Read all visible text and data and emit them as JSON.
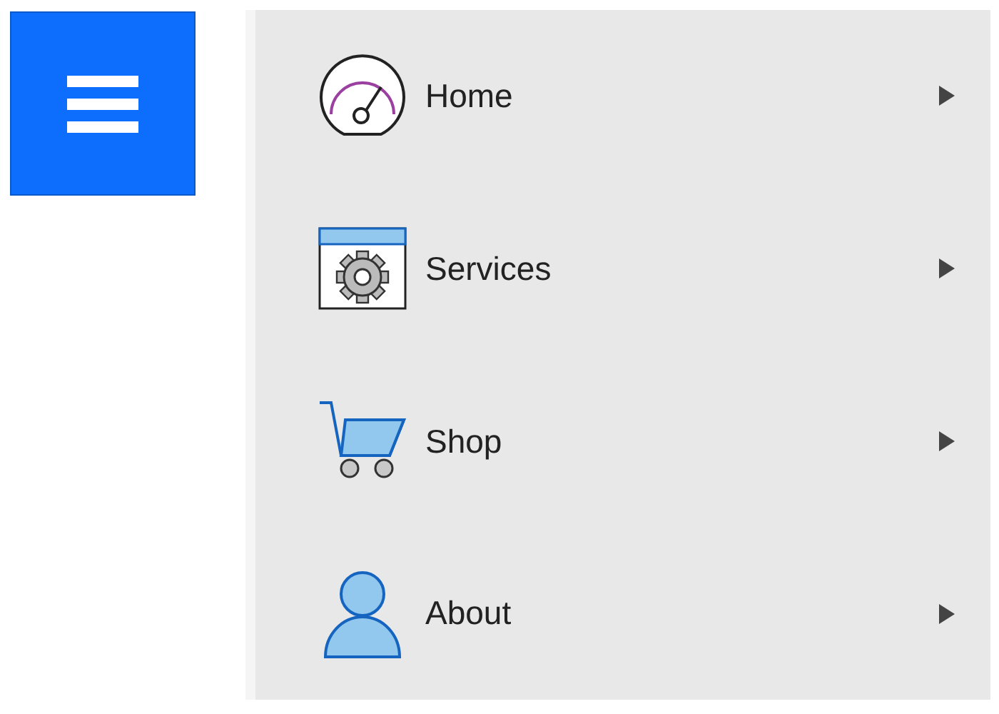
{
  "menu_button": {
    "expanded": true
  },
  "menu": {
    "items": [
      {
        "label": "Home",
        "kind": "gauge"
      },
      {
        "label": "Services",
        "kind": "settings"
      },
      {
        "label": "Shop",
        "kind": "cart"
      },
      {
        "label": "About",
        "kind": "person"
      }
    ]
  }
}
